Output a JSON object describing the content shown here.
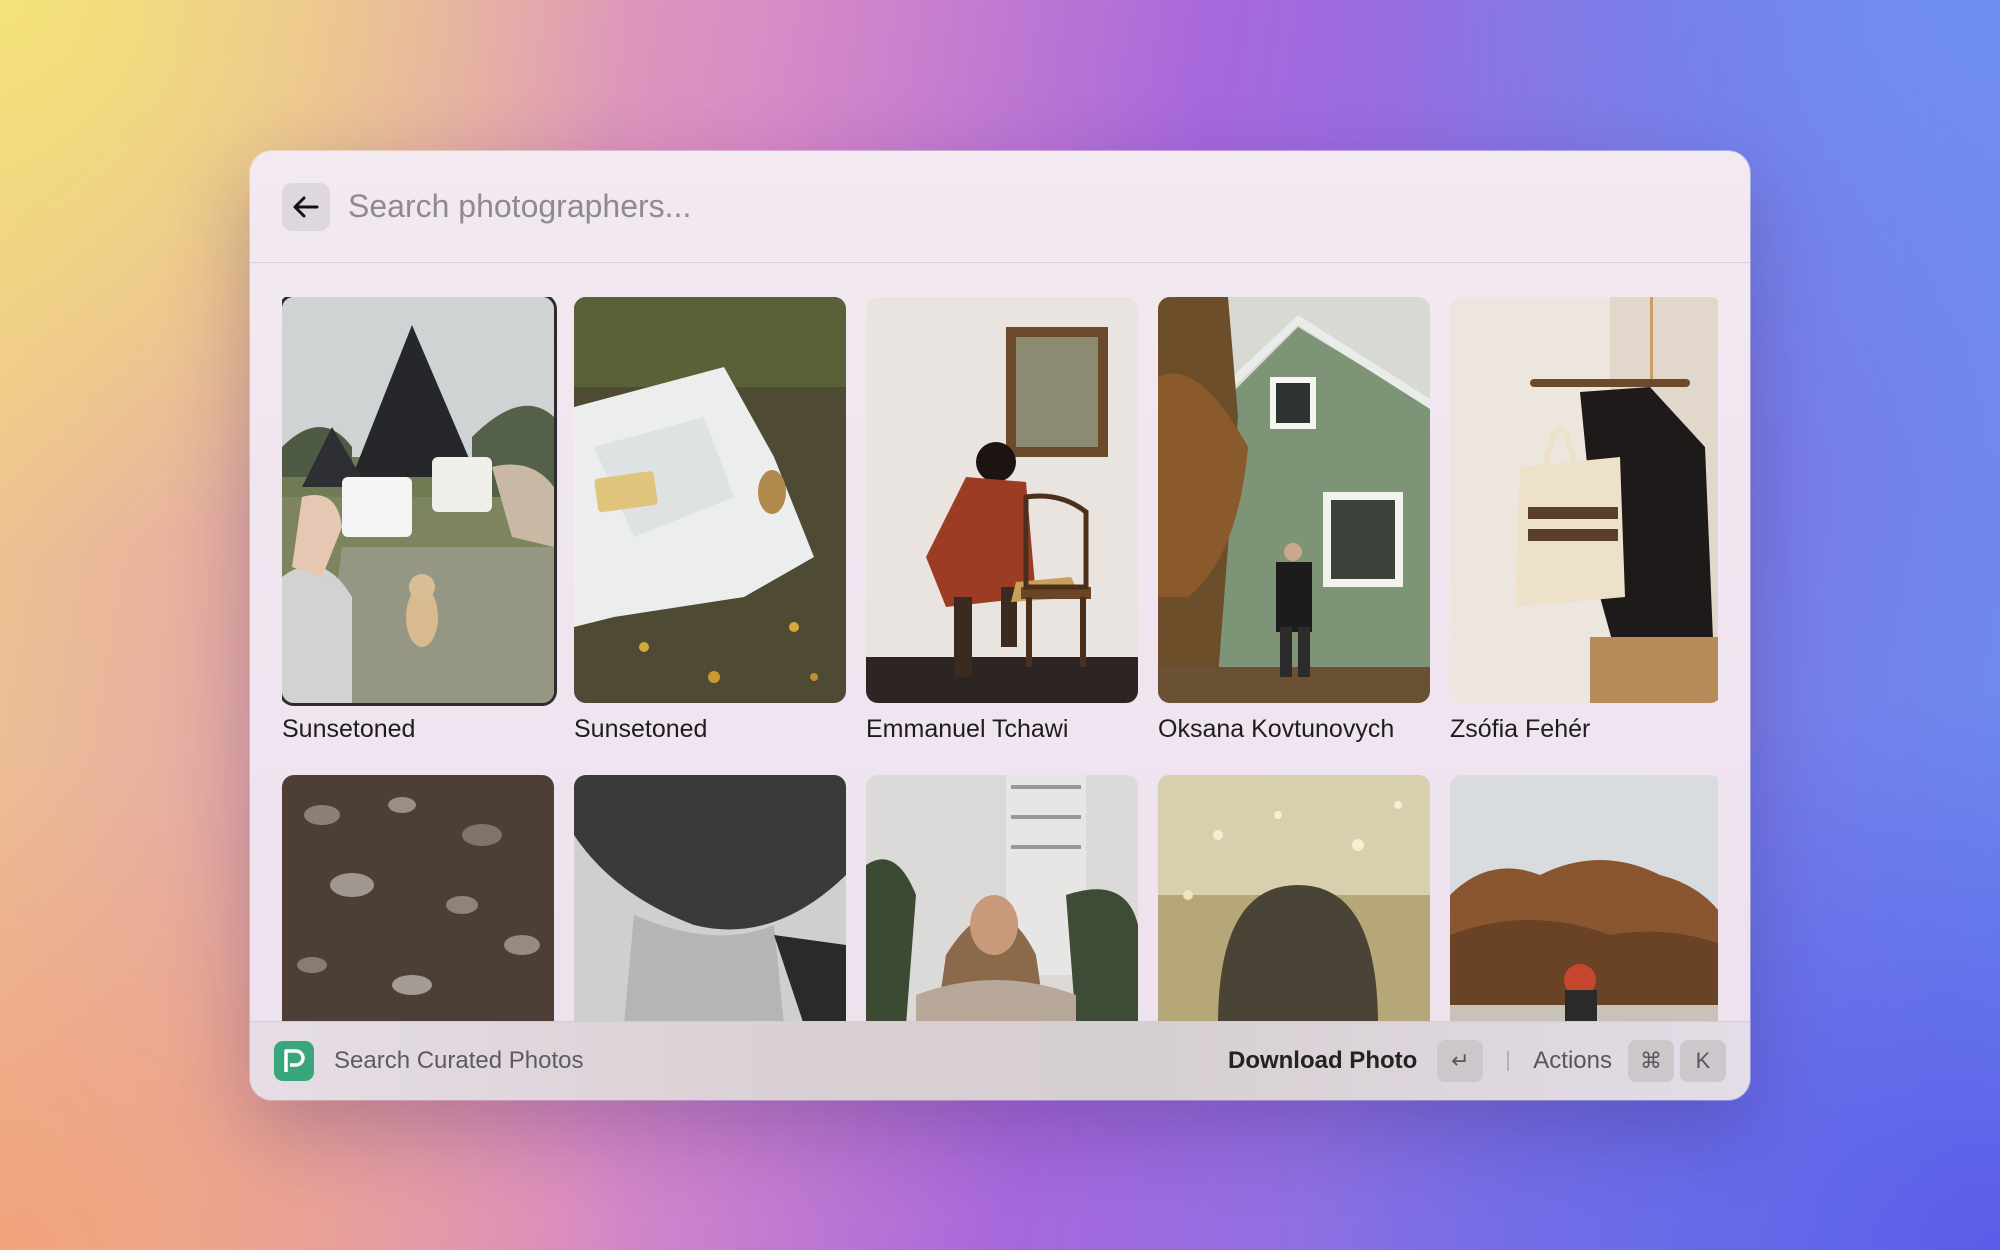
{
  "search": {
    "placeholder": "Search photographers..."
  },
  "photos": [
    {
      "photographer": "Sunsetoned",
      "selected": true
    },
    {
      "photographer": "Sunsetoned",
      "selected": false
    },
    {
      "photographer": "Emmanuel Tchawi",
      "selected": false
    },
    {
      "photographer": "Oksana Kovtunovych",
      "selected": false
    },
    {
      "photographer": "Zsófia Fehér",
      "selected": false
    }
  ],
  "footer": {
    "app_name": "Search Curated Photos",
    "primary_action": "Download Photo",
    "enter_key": "↵",
    "actions_label": "Actions",
    "cmd_key": "⌘",
    "k_key": "K"
  },
  "colors": {
    "app_icon": "#3aa67c",
    "selection_border": "#2c2c2c"
  }
}
